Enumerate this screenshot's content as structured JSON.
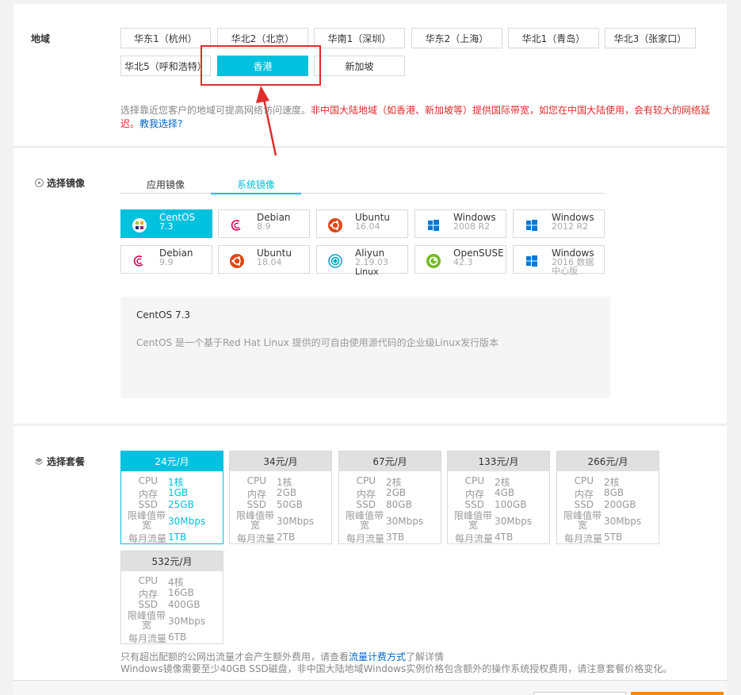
{
  "region": {
    "label": "地域",
    "options": [
      "华东1（杭州）",
      "华北2（北京）",
      "华南1（深圳）",
      "华东2（上海）",
      "华北1（青岛）",
      "华北3（张家口）",
      "华北5（呼和浩特）",
      "香港",
      "新加坡"
    ],
    "selected": "香港",
    "note_gray": "选择靠近您客户的地域可提高网络访问速度。",
    "note_red": "非中国大陆地域（如香港、新加坡等）提供国际带宽，如您在中国大陆使用，会有较大的网络延迟。",
    "note_link": "教我选择?"
  },
  "image": {
    "label": "选择镜像",
    "tabs": [
      "应用镜像",
      "系统镜像"
    ],
    "active_tab": "系统镜像",
    "items": [
      {
        "name": "CentOS",
        "version": "7.3",
        "icon": "centos-icon"
      },
      {
        "name": "Debian",
        "version": "8.9",
        "icon": "debian-icon"
      },
      {
        "name": "Ubuntu",
        "version": "16.04",
        "icon": "ubuntu-icon"
      },
      {
        "name": "Windows",
        "version": "2008 R2",
        "icon": "windows-icon"
      },
      {
        "name": "Windows",
        "version": "2012 R2",
        "icon": "windows-icon"
      },
      {
        "name": "Debian",
        "version": "9.9",
        "icon": "debian-icon"
      },
      {
        "name": "Ubuntu",
        "version": "18.04",
        "icon": "ubuntu-icon"
      },
      {
        "name": "Aliyun",
        "version": "2.19.03",
        "extra": "Linux",
        "icon": "aliyun-icon"
      },
      {
        "name": "OpenSUSE",
        "version": "42.3",
        "icon": "opensuse-icon"
      },
      {
        "name": "Windows",
        "version": "2016 数据中心版",
        "icon": "windows-icon"
      }
    ],
    "selected": "CentOS 7.3",
    "desc_title": "CentOS 7.3",
    "desc_text": "CentOS 是一个基于Red Hat Linux 提供的可自由使用源代码的企业级Linux发行版本"
  },
  "plans": {
    "label": "选择套餐",
    "labels": {
      "cpu": "CPU",
      "mem": "内存",
      "ssd": "SSD",
      "bw": "限峰值带宽",
      "traffic": "每月流量"
    },
    "items": [
      {
        "price": "24元/月",
        "cpu": "1核",
        "mem": "1GB",
        "ssd": "25GB",
        "bw": "30Mbps",
        "traffic": "1TB"
      },
      {
        "price": "34元/月",
        "cpu": "1核",
        "mem": "2GB",
        "ssd": "50GB",
        "bw": "30Mbps",
        "traffic": "2TB"
      },
      {
        "price": "67元/月",
        "cpu": "2核",
        "mem": "2GB",
        "ssd": "80GB",
        "bw": "30Mbps",
        "traffic": "3TB"
      },
      {
        "price": "133元/月",
        "cpu": "2核",
        "mem": "4GB",
        "ssd": "100GB",
        "bw": "30Mbps",
        "traffic": "4TB"
      },
      {
        "price": "266元/月",
        "cpu": "2核",
        "mem": "8GB",
        "ssd": "200GB",
        "bw": "30Mbps",
        "traffic": "5TB"
      },
      {
        "price": "532元/月",
        "cpu": "4核",
        "mem": "16GB",
        "ssd": "400GB",
        "bw": "30Mbps",
        "traffic": "6TB"
      }
    ],
    "selected": "24元/月",
    "note1_a": "只有超出配额的公网出流量才会产生额外费用，请查看",
    "note1_link": "流量计费方式",
    "note1_b": "了解详情",
    "note2": "Windows镜像需要至少40GB SSD磁盘，非中国大陆地域Windows实例价格包含额外的操作系统授权费用，请注意套餐价格变化。"
  },
  "colors": {
    "accent": "#00c1de",
    "highlight": "#e02c2c",
    "warning": "#e02c2c",
    "link": "#0066cc"
  }
}
